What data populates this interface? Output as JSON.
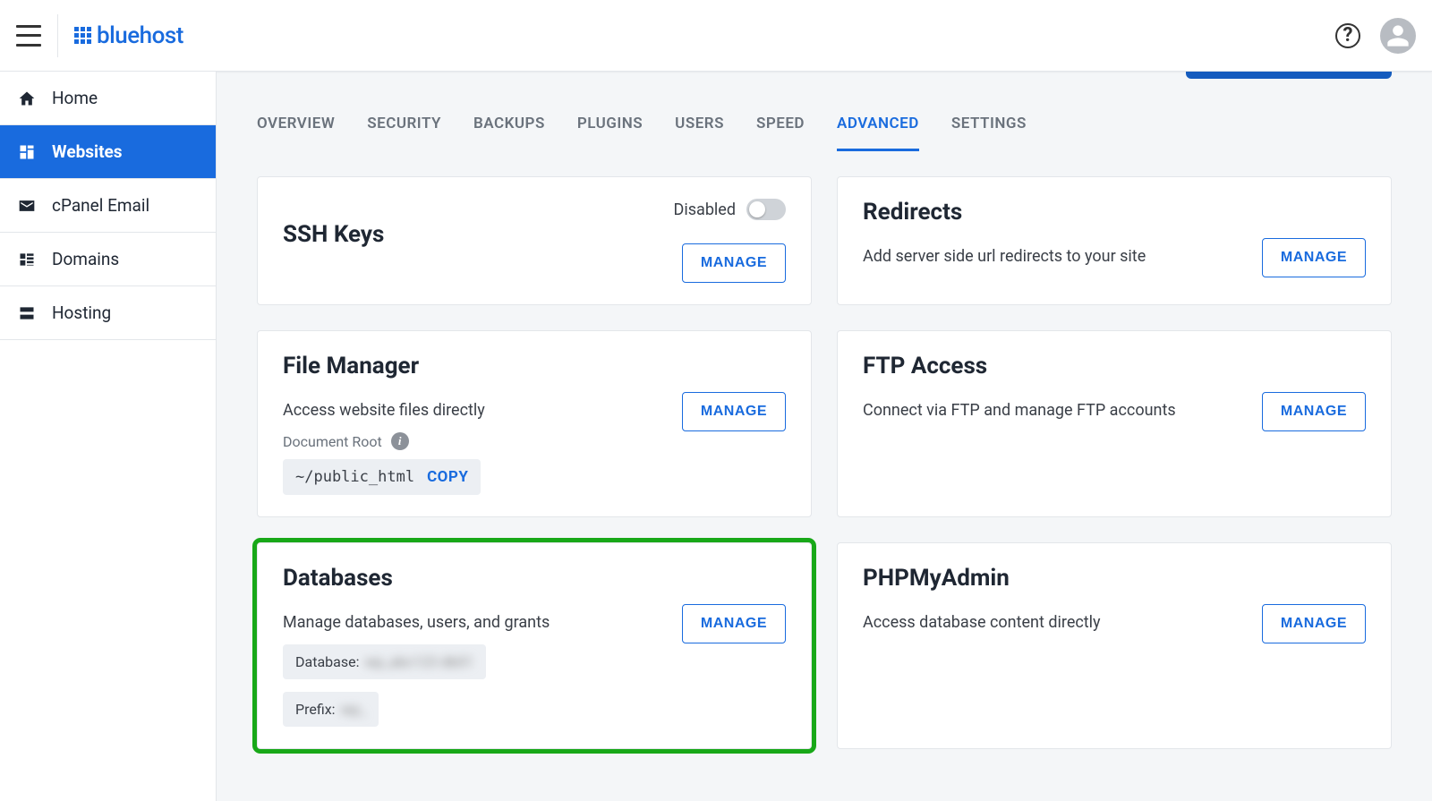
{
  "header": {
    "brand": "bluehost",
    "help_label": "?"
  },
  "sidebar": {
    "items": [
      {
        "label": "Home",
        "icon": "home"
      },
      {
        "label": "Websites",
        "icon": "websites"
      },
      {
        "label": "cPanel Email",
        "icon": "email"
      },
      {
        "label": "Domains",
        "icon": "domains"
      },
      {
        "label": "Hosting",
        "icon": "hosting"
      }
    ],
    "activeIndex": 1
  },
  "tabs": {
    "items": [
      "OVERVIEW",
      "SECURITY",
      "BACKUPS",
      "PLUGINS",
      "USERS",
      "SPEED",
      "ADVANCED",
      "SETTINGS"
    ],
    "activeIndex": 6
  },
  "cards": {
    "ssh": {
      "title": "SSH Keys",
      "toggle_label": "Disabled",
      "manage": "MANAGE"
    },
    "redirects": {
      "title": "Redirects",
      "desc": "Add server side url redirects to your site",
      "manage": "MANAGE"
    },
    "file_manager": {
      "title": "File Manager",
      "desc": "Access website files directly",
      "doc_root_label": "Document Root",
      "doc_root_path": "~/public_html",
      "copy": "COPY",
      "manage": "MANAGE"
    },
    "ftp": {
      "title": "FTP Access",
      "desc": "Connect via FTP and manage FTP accounts",
      "manage": "MANAGE"
    },
    "databases": {
      "title": "Databases",
      "desc": "Manage databases, users, and grants",
      "db_label": "Database:",
      "db_value": "wp_abc123 db01",
      "prefix_label": "Prefix:",
      "prefix_value": "wp_",
      "manage": "MANAGE"
    },
    "phpmyadmin": {
      "title": "PHPMyAdmin",
      "desc": "Access database content directly",
      "manage": "MANAGE"
    }
  }
}
